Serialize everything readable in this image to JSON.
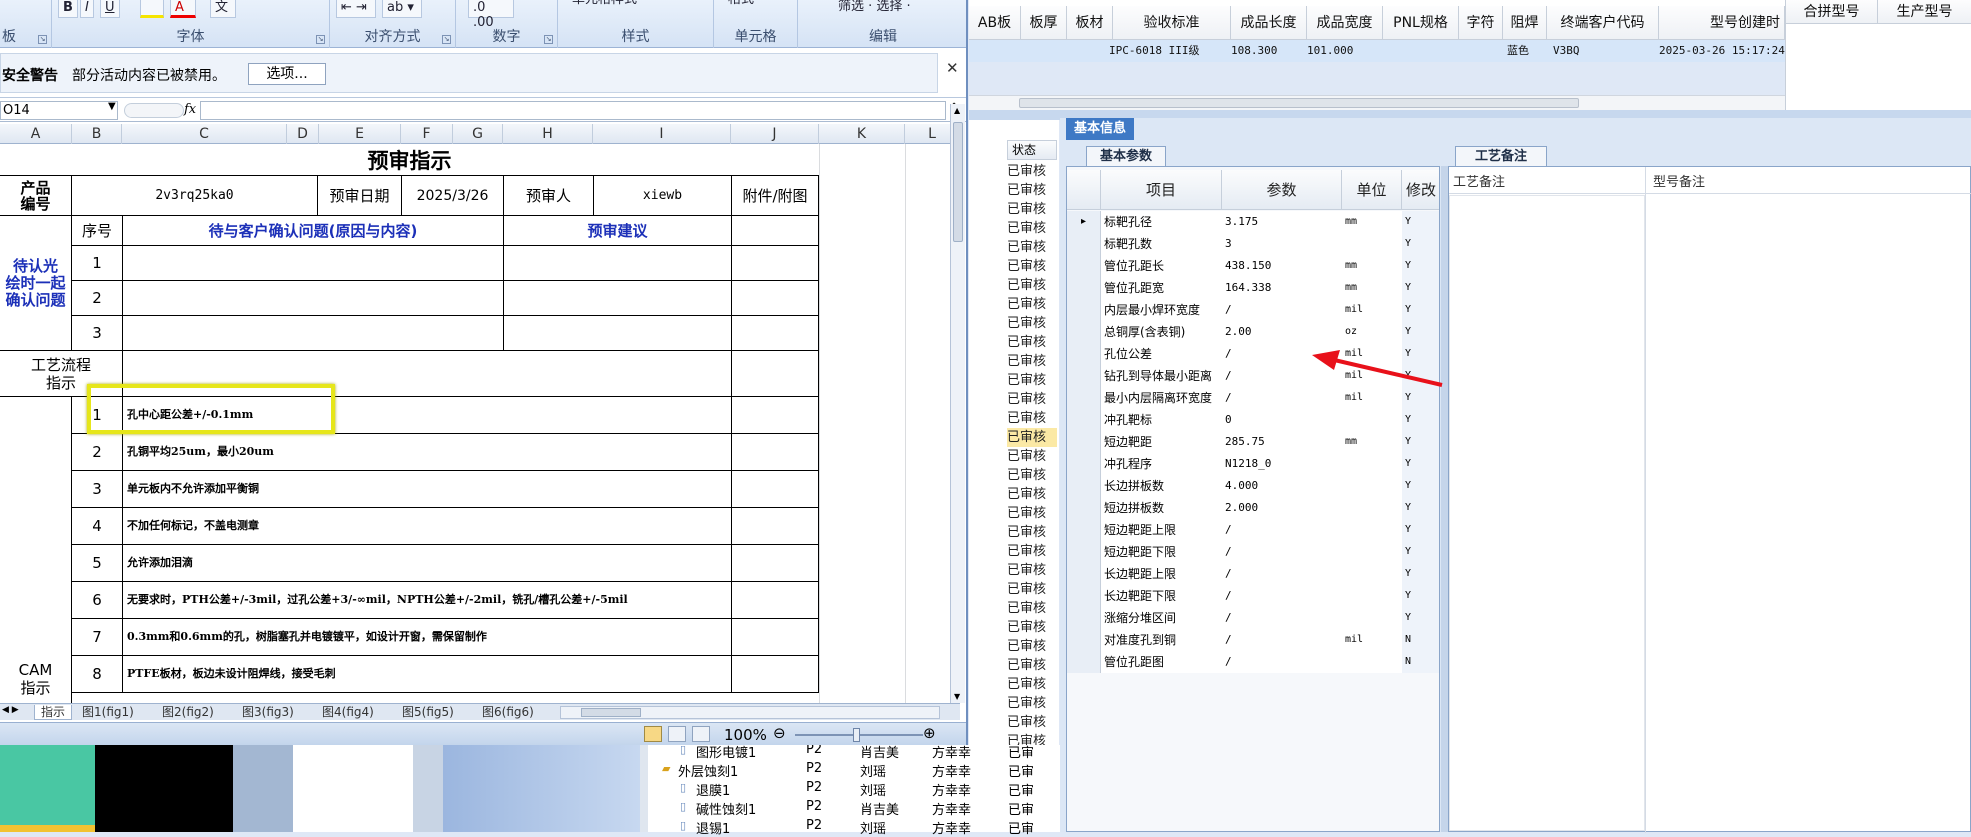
{
  "excel": {
    "ribbon": {
      "groups": [
        "板",
        "字体",
        "对齐方式",
        "数字",
        "样式",
        "单元格",
        "编辑"
      ],
      "partial_buttons": [
        "单元格样式",
        "格式",
        "筛选 · 选择 ·"
      ]
    },
    "security_bar": {
      "title": "安全警告",
      "message": "部分活动内容已被禁用。",
      "options_button": "选项..."
    },
    "name_box": "O14",
    "fx_label": "fx",
    "columns": [
      "A",
      "B",
      "C",
      "D",
      "E",
      "F",
      "G",
      "H",
      "I",
      "J",
      "K",
      "L"
    ],
    "sheet": {
      "title": "预审指示",
      "product_label": "产品\n编号",
      "product_value": "2v3rq25ka0",
      "review_date_label": "预审日期",
      "review_date_value": "2025/3/26",
      "reviewer_label": "预审人",
      "reviewer_value": "xiewb",
      "attachment_label": "附件/附图",
      "seq_label": "序号",
      "issues_header": "待与客户确认问题(原因与内容)",
      "advice_header": "预审建议",
      "confirm_label": "待认光\n绘时一起\n确认问题",
      "confirm_rows": [
        "1",
        "2",
        "3"
      ],
      "process_label": "工艺流程\n指示",
      "cam_label": "CAM\n指示",
      "items": [
        {
          "no": "1",
          "text": "孔中心距公差+/-0.1mm"
        },
        {
          "no": "2",
          "text": "孔铜平均25um，最小20um"
        },
        {
          "no": "3",
          "text": "单元板内不允许添加平衡铜"
        },
        {
          "no": "4",
          "text": "不加任何标记，不盖电测章"
        },
        {
          "no": "5",
          "text": "允许添加泪滴"
        },
        {
          "no": "6",
          "text": "无要求时，PTH公差+/-3mil，过孔公差+3/-∞mil，NPTH公差+/-2mil，铣孔/槽孔公差+/-5mil"
        },
        {
          "no": "7",
          "text": "0.3mm和0.6mm的孔，树脂塞孔并电镀镀平，如设计开窗，需保留制作"
        },
        {
          "no": "8",
          "text": "PTFE板材，板边未设计阻焊线，接受毛刺"
        }
      ]
    },
    "sheet_tabs": [
      "指示",
      "图1(fig1)",
      "图2(fig2)",
      "图3(fig3)",
      "图4(fig4)",
      "图5(fig5)",
      "图6(fig6)"
    ],
    "zoom": "100%"
  },
  "top_grid": {
    "headers": [
      "AB板",
      "板厚",
      "板材",
      "验收标准",
      "成品长度",
      "成品宽度",
      "PNL规格",
      "字符",
      "阻焊",
      "终端客户代码",
      "型号创建时"
    ],
    "row": {
      "acceptance": "IPC-6018 III级",
      "length": "108.300",
      "width": "101.000",
      "mask": "蓝色",
      "customer_code": "V3BQ",
      "created": "2025-03-26 15:17:24"
    },
    "far_right_headers": [
      "合拼型号",
      "生产型号"
    ]
  },
  "tree": {
    "status_header": "状态",
    "status_value": "已审核",
    "status_partial": "已审",
    "rows_bottom": [
      {
        "name": "图形电镀1",
        "col2": "P2",
        "col3": "肖吉美",
        "col4": "方幸幸"
      },
      {
        "name": "外层蚀刻1",
        "col2": "P2",
        "col3": "刘瑶",
        "col4": "方幸幸"
      },
      {
        "name": "退膜1",
        "col2": "P2",
        "col3": "刘瑶",
        "col4": "方幸幸"
      },
      {
        "name": "碱性蚀刻1",
        "col2": "P2",
        "col3": "肖吉美",
        "col4": "方幸幸"
      },
      {
        "name": "退锡1",
        "col2": "P2",
        "col3": "刘瑶",
        "col4": "方幸幸"
      }
    ]
  },
  "info_panel": {
    "tab": "基本信息",
    "subtab": "基本参数",
    "remark_tab": "工艺备注",
    "remark_headers": [
      "工艺备注",
      "型号备注"
    ],
    "columns": [
      "项目",
      "参数",
      "单位",
      "修改"
    ],
    "rows": [
      {
        "name": "标靶孔径",
        "value": "3.175",
        "unit": "mm",
        "mod": "Y"
      },
      {
        "name": "标靶孔数",
        "value": "3",
        "unit": "",
        "mod": "Y"
      },
      {
        "name": "管位孔距长",
        "value": "438.150",
        "unit": "mm",
        "mod": "Y"
      },
      {
        "name": "管位孔距宽",
        "value": "164.338",
        "unit": "mm",
        "mod": "Y"
      },
      {
        "name": "内层最小焊环宽度",
        "value": "/",
        "unit": "mil",
        "mod": "Y"
      },
      {
        "name": "总铜厚(含表铜)",
        "value": "2.00",
        "unit": "oz",
        "mod": "Y"
      },
      {
        "name": "孔位公差",
        "value": "/",
        "unit": "mil",
        "mod": "Y"
      },
      {
        "name": "钻孔到导体最小距离",
        "value": "/",
        "unit": "mil",
        "mod": "Y"
      },
      {
        "name": "最小内层隔离环宽度",
        "value": "/",
        "unit": "mil",
        "mod": "Y"
      },
      {
        "name": "冲孔靶标",
        "value": "0",
        "unit": "",
        "mod": "Y"
      },
      {
        "name": "短边靶距",
        "value": "285.75",
        "unit": "mm",
        "mod": "Y"
      },
      {
        "name": "冲孔程序",
        "value": "N1218_0",
        "unit": "",
        "mod": "Y"
      },
      {
        "name": "长边拼板数",
        "value": "4.000",
        "unit": "",
        "mod": "Y"
      },
      {
        "name": "短边拼板数",
        "value": "2.000",
        "unit": "",
        "mod": "Y"
      },
      {
        "name": "短边靶距上限",
        "value": "/",
        "unit": "",
        "mod": "Y"
      },
      {
        "name": "短边靶距下限",
        "value": "/",
        "unit": "",
        "mod": "Y"
      },
      {
        "name": "长边靶距上限",
        "value": "/",
        "unit": "",
        "mod": "Y"
      },
      {
        "name": "长边靶距下限",
        "value": "/",
        "unit": "",
        "mod": "Y"
      },
      {
        "name": "涨缩分堆区间",
        "value": "/",
        "unit": "",
        "mod": "Y"
      },
      {
        "name": "对准度孔到铜",
        "value": "/",
        "unit": "mil",
        "mod": "N"
      },
      {
        "name": "管位孔距图",
        "value": "/",
        "unit": "",
        "mod": "N"
      }
    ]
  },
  "colors": {
    "highlight_box": "#e6e619",
    "arrow": "#e8111a",
    "tab_blue": "#3e79c5",
    "issue_text": "#1c30b8"
  }
}
